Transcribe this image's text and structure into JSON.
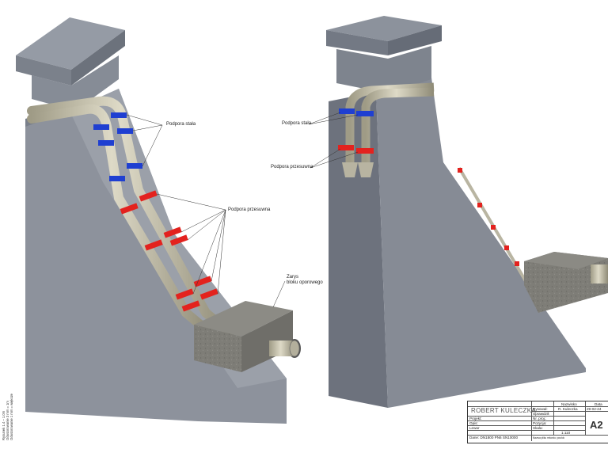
{
  "callouts": {
    "left_fixed": "Podpora stała",
    "left_sliding": "Podpora przesuwna",
    "left_block_line1": "Zarys",
    "left_block_line2": "bloku oporowego",
    "right_fixed": "Podpora stała",
    "right_sliding": "Podpora przesuwna"
  },
  "side_note": {
    "line1": "Rysunek 1.4 – 1.0m",
    "line2": "Odwzorowanie 3 mm = 1m",
    "line3": "Odwzorowanie 1 mm = większe"
  },
  "title_block": {
    "logo": "ROBERT KULECZKA",
    "col_name": "Nazwisko",
    "col_date": "Data",
    "row_drawn": "Rysował:",
    "row_checked": "Sprawdził:",
    "drawn_name": "R. Kuleczka",
    "drawn_date": "29-02-24",
    "project_label": "Projekt:",
    "project_no": "Nr. proj.:",
    "desc_label": "Opis:",
    "position_label": "Pozycja:",
    "author_label": "Lewar",
    "scale_label": "Skala:",
    "scale_value": "1:110",
    "data_label": "Dane: DN1800 PN6 SN10000",
    "tiny_note": "Nazwa pliku rekordu: pos/ok",
    "sheet_no": "A2"
  },
  "colors": {
    "concrete_face": "#8a8f99",
    "concrete_dark": "#6f7480",
    "pipe": "#c9c5b1",
    "fixed_support": "#1f3fd1",
    "sliding_support": "#e3221e",
    "block": "#7b7b76"
  }
}
